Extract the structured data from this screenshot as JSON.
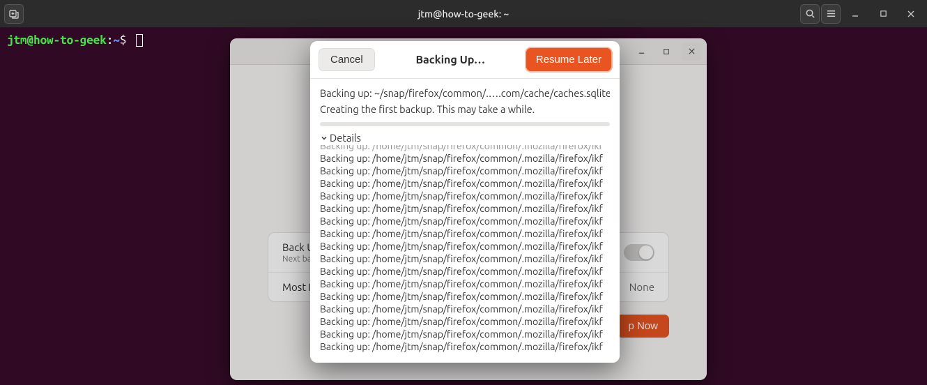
{
  "titlebar": {
    "title": "jtm@how-to-geek: ~",
    "new_tab_icon": "new-tab-icon",
    "search_icon": "search-icon",
    "menu_icon": "hamburger-icon",
    "min_icon": "minimize-icon",
    "max_icon": "maximize-icon",
    "close_icon": "close-icon"
  },
  "terminal": {
    "user_host": "jtm@how-to-geek",
    "colon": ":",
    "path": "~",
    "dollar": "$"
  },
  "settings": {
    "backup_label": "Back Up",
    "next_label": "Next bac",
    "recent_label": "Most R",
    "recent_value": "None",
    "primary_btn_suffix": "p Now"
  },
  "dialog": {
    "cancel": "Cancel",
    "title": "Backing Up…",
    "resume": "Resume Later",
    "status": "Backing up: ~/snap/firefox/common/.….com/cache/caches.sqlite",
    "note": "Creating the first backup.  This may take a while.",
    "details_label": "Details",
    "log_cut": "Backing up: /home/jtm/snap/firefox/common/.mozilla/firefox/ikf",
    "logs": [
      "Backing up: /home/jtm/snap/firefox/common/.mozilla/firefox/ikf",
      "Backing up: /home/jtm/snap/firefox/common/.mozilla/firefox/ikf",
      "Backing up: /home/jtm/snap/firefox/common/.mozilla/firefox/ikf",
      "Backing up: /home/jtm/snap/firefox/common/.mozilla/firefox/ikf",
      "Backing up: /home/jtm/snap/firefox/common/.mozilla/firefox/ikf",
      "Backing up: /home/jtm/snap/firefox/common/.mozilla/firefox/ikf",
      "Backing up: /home/jtm/snap/firefox/common/.mozilla/firefox/ikf",
      "Backing up: /home/jtm/snap/firefox/common/.mozilla/firefox/ikf",
      "Backing up: /home/jtm/snap/firefox/common/.mozilla/firefox/ikf",
      "Backing up: /home/jtm/snap/firefox/common/.mozilla/firefox/ikf",
      "Backing up: /home/jtm/snap/firefox/common/.mozilla/firefox/ikf",
      "Backing up: /home/jtm/snap/firefox/common/.mozilla/firefox/ikf",
      "Backing up: /home/jtm/snap/firefox/common/.mozilla/firefox/ikf",
      "Backing up: /home/jtm/snap/firefox/common/.mozilla/firefox/ikf",
      "Backing up: /home/jtm/snap/firefox/common/.mozilla/firefox/ikf",
      "Backing up: /home/jtm/snap/firefox/common/.mozilla/firefox/ikf"
    ]
  }
}
